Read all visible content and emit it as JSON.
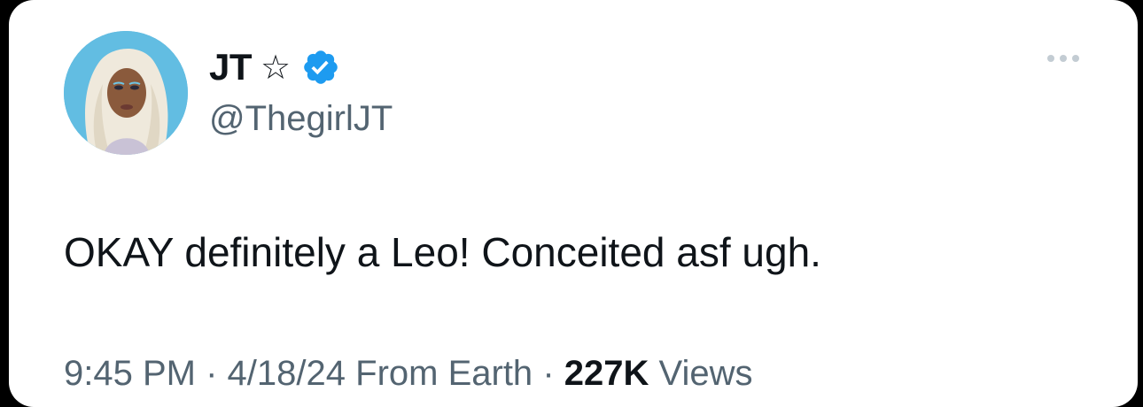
{
  "tweet": {
    "author": {
      "display_name": "JT",
      "name_symbol": "☆",
      "handle": "@ThegirlJT",
      "verified_color": "#1d9bf0"
    },
    "text": "OKAY definitely a Leo! Conceited asf ugh.",
    "meta": {
      "time": "9:45 PM",
      "separator": "·",
      "date": "4/18/24",
      "source": "From Earth",
      "views_count": "227K",
      "views_label": "Views"
    }
  },
  "icons": {
    "verified": "verified-badge-icon",
    "more": "more-icon"
  }
}
